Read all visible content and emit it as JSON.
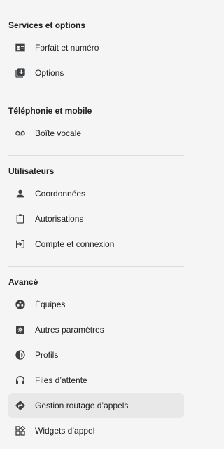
{
  "sections": [
    {
      "title": "Services et options",
      "items": [
        {
          "label": "Forfait et numéro",
          "icon": "contact-card-icon"
        },
        {
          "label": "Options",
          "icon": "add-box-icon"
        }
      ]
    },
    {
      "title": "Téléphonie et mobile",
      "items": [
        {
          "label": "Boîte vocale",
          "icon": "voicemail-icon"
        }
      ]
    },
    {
      "title": "Utilisateurs",
      "items": [
        {
          "label": "Coordonnées",
          "icon": "person-icon"
        },
        {
          "label": "Autorisations",
          "icon": "clipboard-icon"
        },
        {
          "label": "Compte et connexion",
          "icon": "login-icon"
        }
      ]
    },
    {
      "title": "Avancé",
      "items": [
        {
          "label": "Équipes",
          "icon": "teams-icon"
        },
        {
          "label": "Autres paramètres",
          "icon": "settings-icon"
        },
        {
          "label": "Profils",
          "icon": "profile-contrast-icon"
        },
        {
          "label": "Files d’attente",
          "icon": "headset-icon"
        },
        {
          "label": "Gestion routage d’appels",
          "icon": "routing-icon",
          "active": true
        },
        {
          "label": "Widgets d’appel",
          "icon": "widgets-icon"
        }
      ]
    }
  ],
  "colors": {
    "background": "#f5f5f5",
    "active_item": "#e8e8e8",
    "text": "#202124",
    "divider": "#dadce0"
  }
}
